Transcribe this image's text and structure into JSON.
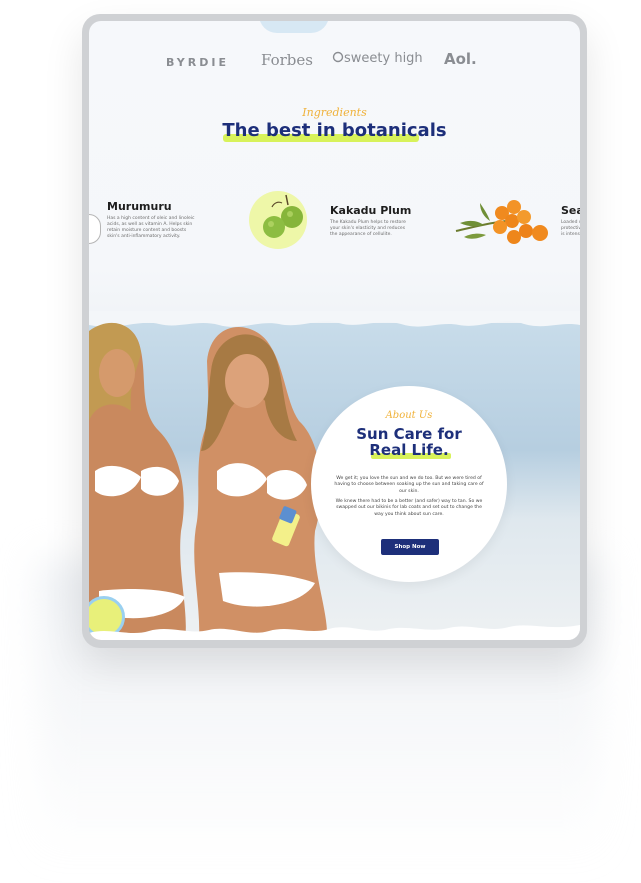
{
  "press_logos": {
    "byrdie": "BYRDIE",
    "forbes": "Forbes",
    "sweety_high": "sweety high",
    "aol": "Aol."
  },
  "ingredients_section": {
    "kicker": "Ingredients",
    "title": "The best in botanicals",
    "items": [
      {
        "name": "Murumuru",
        "description": "Has a high content of oleic and linoleic acids, as well as vitamin A. Helps skin retain moisture content and boosts skin's anti-inflammatory activity."
      },
      {
        "name": "Kakadu Plum",
        "description": "The Kakadu Plum helps to restore your skin's elasticity and reduces the appearance of cellulite."
      },
      {
        "name": "Sea",
        "description": "Loaded with antioxidants, protective properties and is intensely moisturizing."
      }
    ]
  },
  "about_section": {
    "kicker": "About Us",
    "title_line1": "Sun Care for",
    "title_line2": "Real Life.",
    "paragraph1": "We get it; you love the sun and we do too. But we were tired of having to choose between soaking up the sun and taking care of our skin.",
    "paragraph2": "We knew there had to be a better (and safer) way to tan. So we swapped out our bikinis for lab coats and set out to change the way you think about sun care.",
    "cta_label": "Shop Now"
  },
  "colors": {
    "brand_navy": "#1d2f7a",
    "accent_yellow": "#f0b23a",
    "highlight_lime": "#d8f25a"
  }
}
